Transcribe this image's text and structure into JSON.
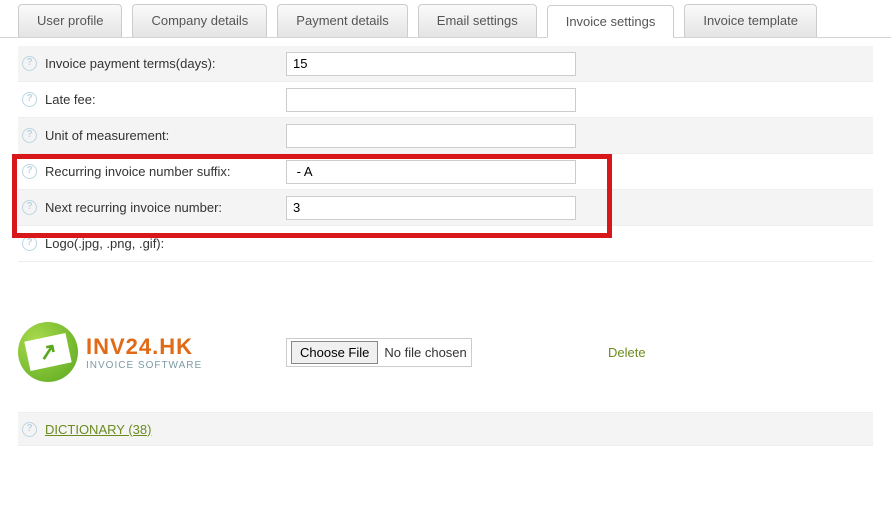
{
  "tabs": {
    "user_profile": "User profile",
    "company_details": "Company details",
    "payment_details": "Payment details",
    "email_settings": "Email settings",
    "invoice_settings": "Invoice settings",
    "invoice_template": "Invoice template"
  },
  "fields": {
    "payment_terms": {
      "label": "Invoice payment terms(days):",
      "value": "15"
    },
    "late_fee": {
      "label": "Late fee:",
      "value": ""
    },
    "unit_measurement": {
      "label": "Unit of measurement:",
      "value": ""
    },
    "recurring_suffix": {
      "label": "Recurring invoice number suffix:",
      "value": " - A"
    },
    "next_recurring": {
      "label": "Next recurring invoice number:",
      "value": "3"
    },
    "logo": {
      "label": "Logo(.jpg, .png, .gif):"
    }
  },
  "logo": {
    "title": "INV24.HK",
    "subtitle": "INVOICE SOFTWARE"
  },
  "file": {
    "button": "Choose File",
    "status": "No file chosen",
    "delete": "Delete"
  },
  "dictionary": {
    "label": "DICTIONARY (38)"
  }
}
